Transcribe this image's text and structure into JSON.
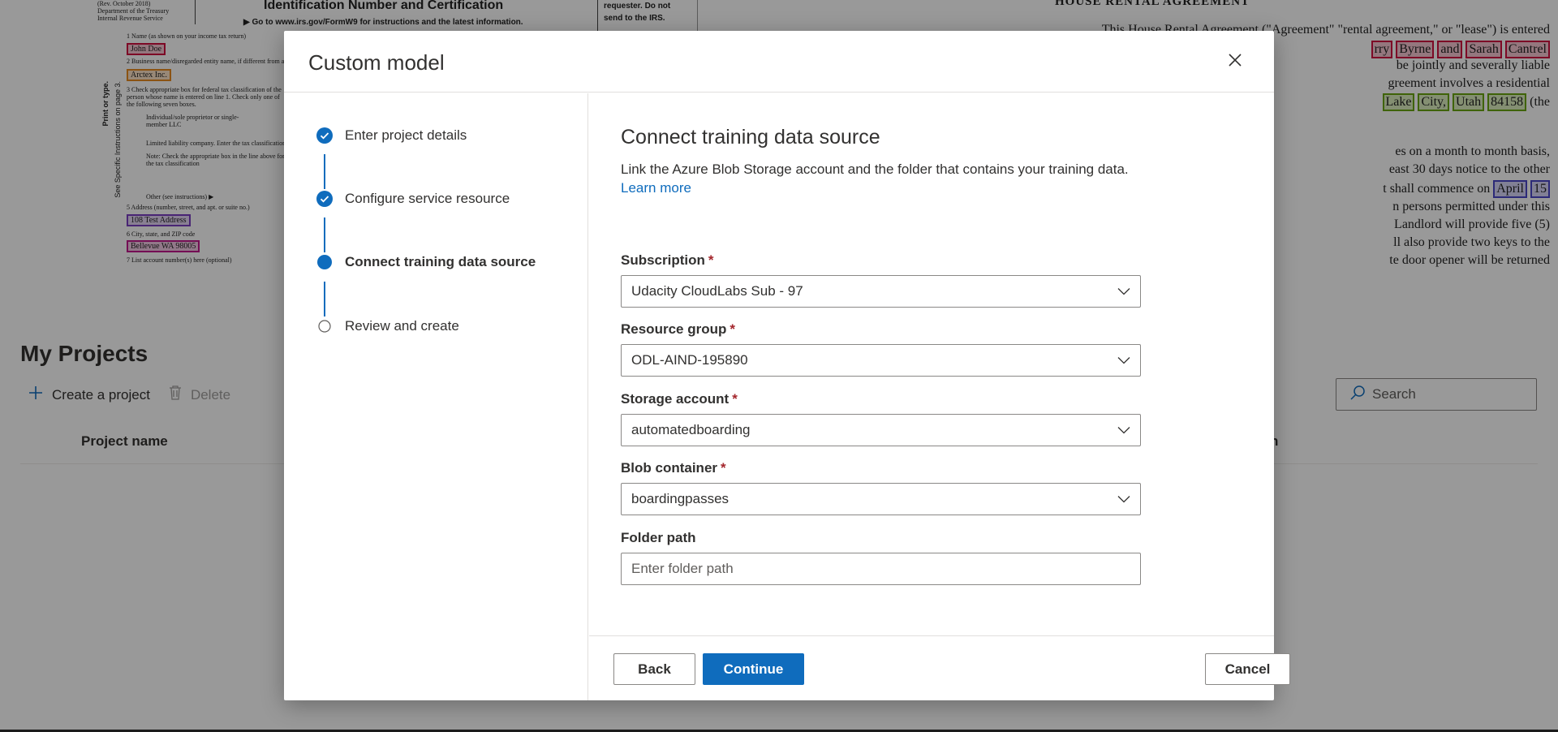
{
  "background": {
    "form_left": {
      "header_lines": [
        "(Rev. October 2018)",
        "Department of the Treasury",
        "Internal Revenue Service"
      ],
      "title": "Identification Number and Certification",
      "goto_text": "▶ Go to www.irs.gov/FormW9 for instructions and the latest information.",
      "requester_note": [
        "requester. Do not",
        "send to the IRS."
      ],
      "rows": [
        "1  Name (as shown on your income tax return)",
        "2  Business name/disregarded entity name, if different from above",
        "3  Check appropriate box for federal tax classification of the person whose name is entered on line 1. Check only one of the following seven boxes.",
        "Individual/sole proprietor or single-member LLC",
        "Limited liability company. Enter the tax classification",
        "Note: Check the appropriate box in the line above for the tax classification",
        "Other (see instructions) ▶",
        "5  Address (number, street, and apt. or suite no.)",
        "6  City, state, and ZIP code",
        "7  List account number(s) here (optional)"
      ],
      "side_text": "Print or type.",
      "side_text2": "See Specific Instructions on page 3.",
      "highlight_name": "John Doe",
      "highlight_business": "Arctex Inc.",
      "highlight_address": "108 Test Address",
      "highlight_city": "Bellevue WA 98005"
    },
    "form_right": {
      "title": "HOUSE RENTAL AGREEMENT",
      "lines": [
        "This House Rental Agreement (\"Agreement\" \"rental agreement,\" or \"lease\") is entered",
        "be jointly and severally liable",
        "greement involves a residential",
        "(the",
        "es on a month to month basis,",
        "east 30 days notice to the other",
        "t shall commence on",
        "n persons permitted under this",
        "Landlord will provide five (5)",
        "ll also provide two keys to the",
        "te door opener will be returned"
      ],
      "tags_line2": [
        "rry",
        "Byrne",
        "and",
        "Sarah",
        "Cantrel"
      ],
      "tags_line5": [
        "Lake",
        "City,",
        "Utah",
        "84158"
      ],
      "tags_line8": [
        "April",
        "15"
      ]
    },
    "projects": {
      "title": "My Projects",
      "create_label": "Create a project",
      "delete_label": "Delete",
      "search_placeholder": "Search",
      "col_project_name": "Project name",
      "col_right_fragment": "n"
    }
  },
  "modal": {
    "title": "Custom model",
    "close_icon": "close-icon",
    "steps": [
      {
        "label": "Enter project details",
        "state": "completed"
      },
      {
        "label": "Configure service resource",
        "state": "completed"
      },
      {
        "label": "Connect training data source",
        "state": "current"
      },
      {
        "label": "Review and create",
        "state": "pending"
      }
    ],
    "section": {
      "title": "Connect training data source",
      "description": "Link the Azure Blob Storage account and the folder that contains your training data.",
      "learn_more": "Learn more"
    },
    "fields": {
      "subscription": {
        "label": "Subscription",
        "required": "*",
        "value": "Udacity CloudLabs Sub - 97"
      },
      "resource_group": {
        "label": "Resource group",
        "required": "*",
        "value": "ODL-AIND-195890"
      },
      "storage_account": {
        "label": "Storage account",
        "required": "*",
        "value": "automatedboarding"
      },
      "blob_container": {
        "label": "Blob container",
        "required": "*",
        "value": "boardingpasses"
      },
      "folder_path": {
        "label": "Folder path",
        "value": "",
        "placeholder": "Enter folder path"
      }
    },
    "footer": {
      "back": "Back",
      "continue": "Continue",
      "cancel": "Cancel"
    },
    "colors": {
      "accent": "#0f6cbd",
      "required": "#a4262c",
      "overlay": "rgba(0,0,0,0.4)"
    }
  }
}
